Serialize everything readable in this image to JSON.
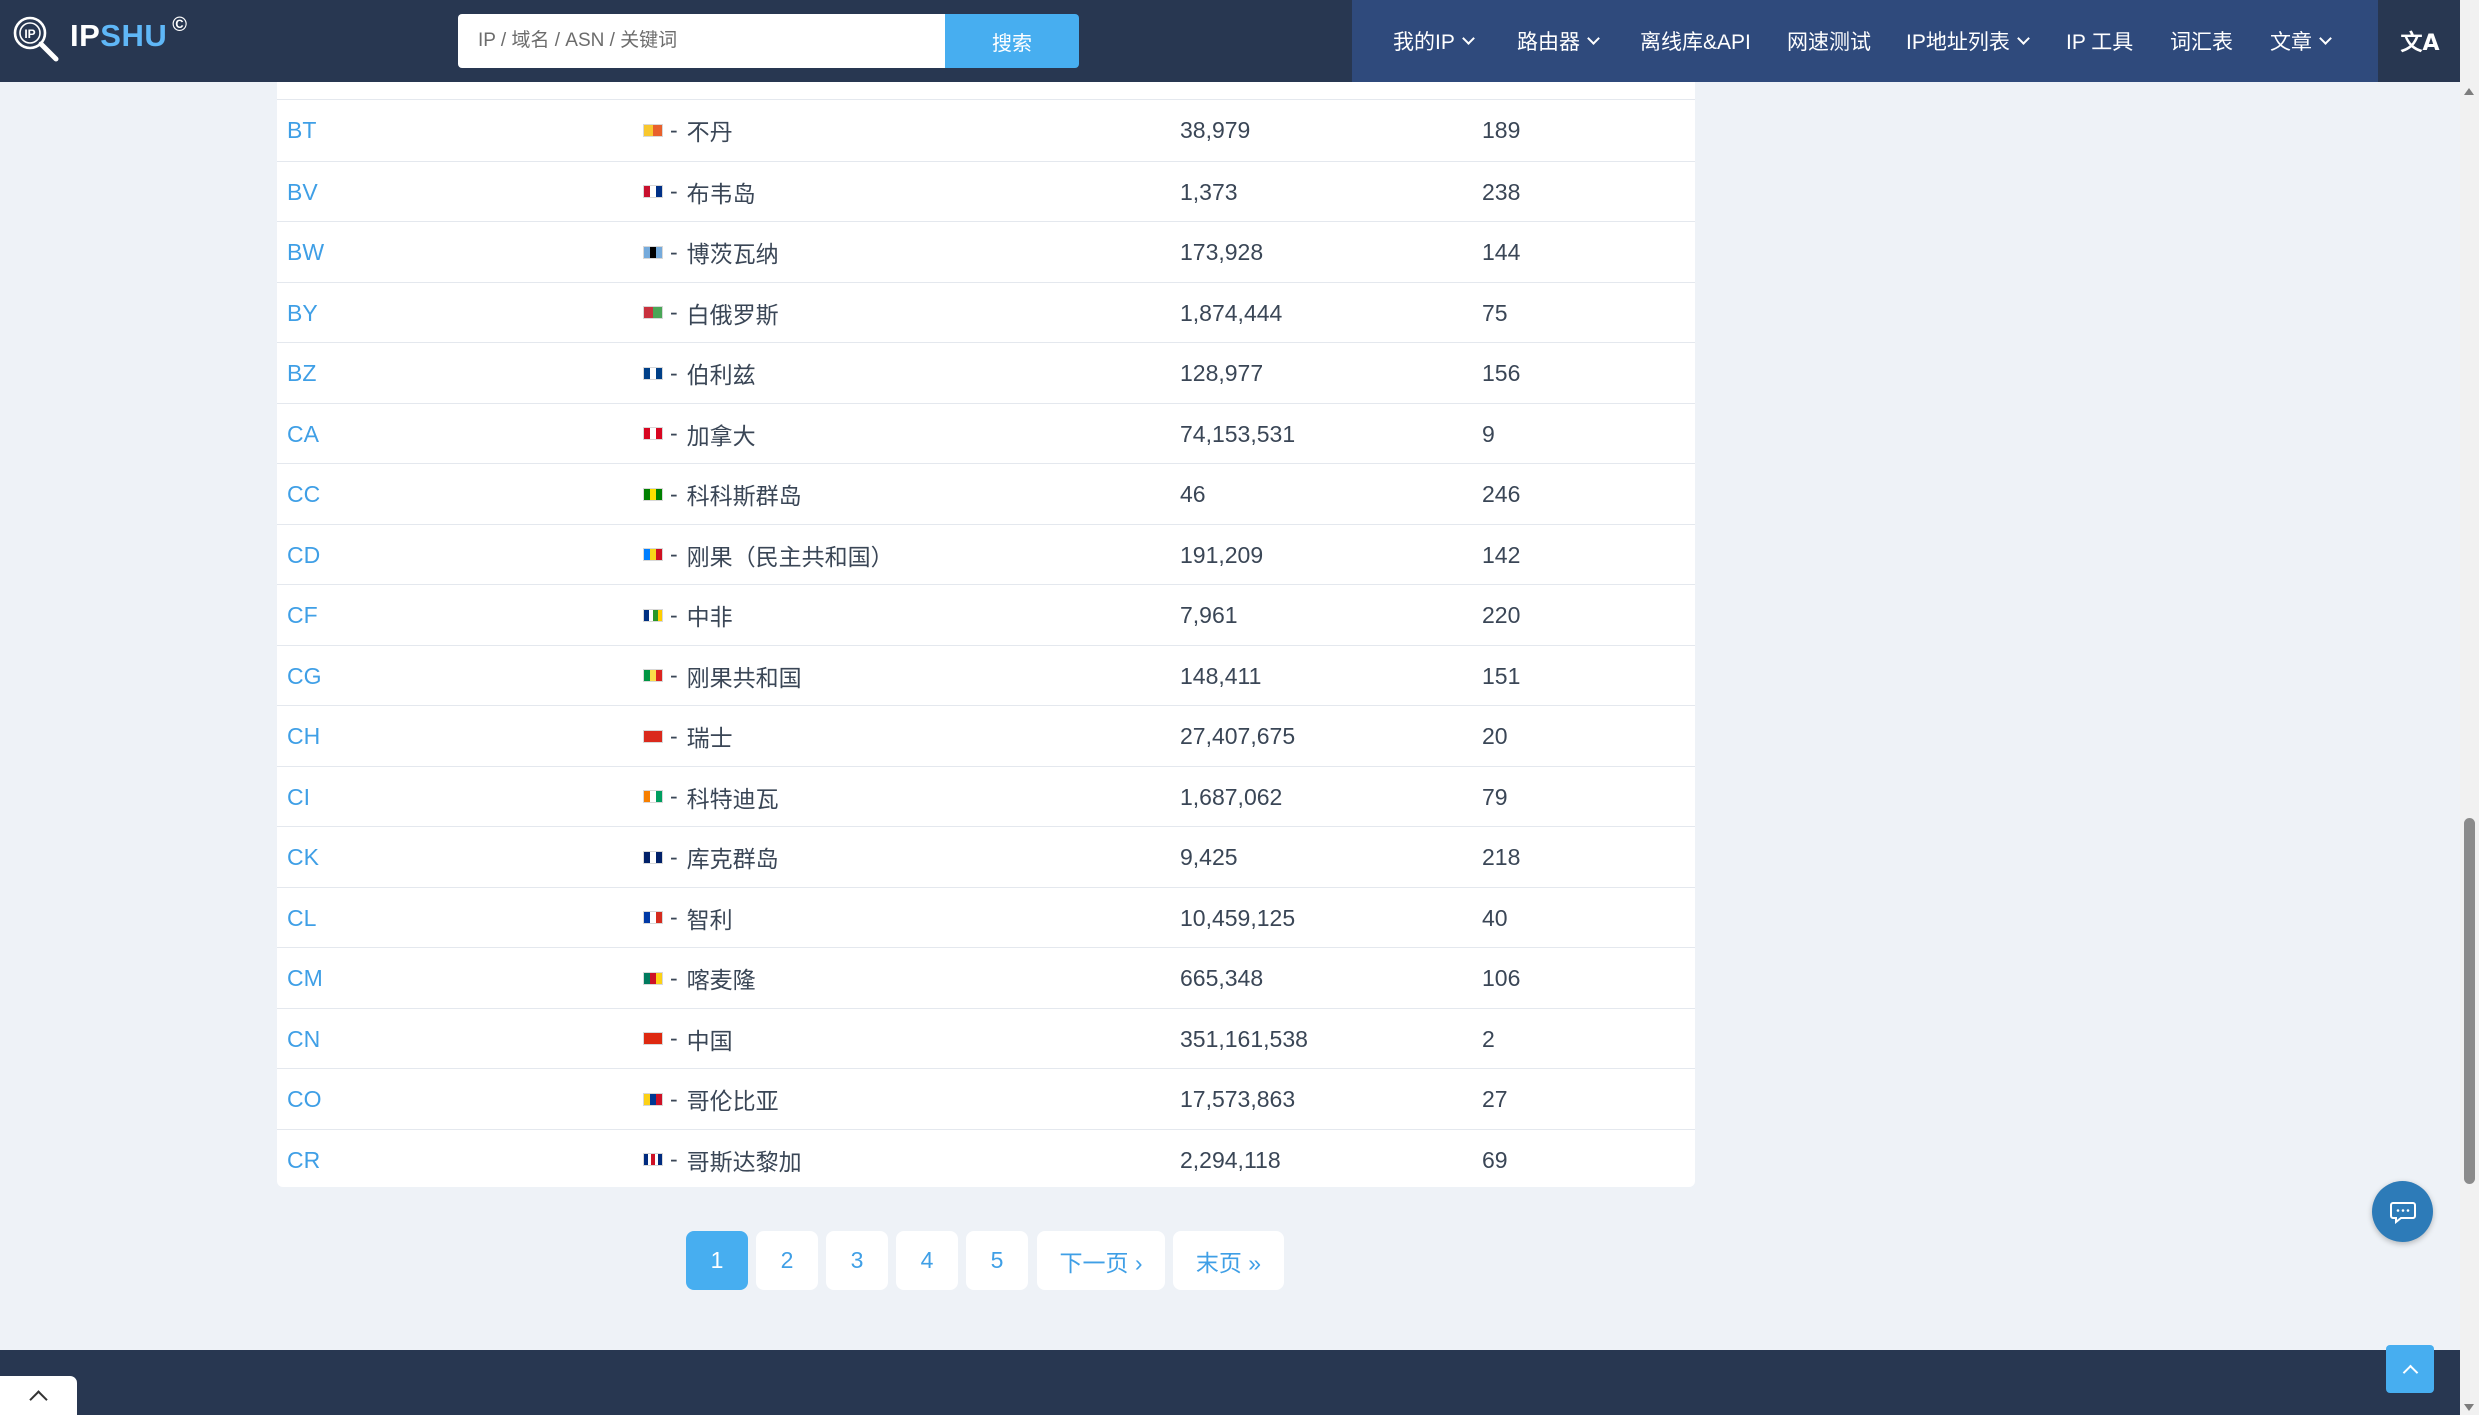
{
  "header": {
    "logo_text_a": "IP",
    "logo_text_b": "SHU",
    "logo_mark": "©",
    "logo_icon": "magnifier-ip-icon",
    "search_placeholder": "IP / 域名 / ASN / 关键词",
    "search_button": "搜索",
    "menu": [
      {
        "label": "我的IP",
        "dropdown": true
      },
      {
        "label": "路由器",
        "dropdown": true
      },
      {
        "label": "离线库&API",
        "dropdown": false
      },
      {
        "label": "网速测试",
        "dropdown": false
      },
      {
        "label": "IP地址列表",
        "dropdown": true
      },
      {
        "label": "IP 工具",
        "dropdown": false
      },
      {
        "label": "词汇表",
        "dropdown": false
      },
      {
        "label": "文章",
        "dropdown": true
      }
    ],
    "language_icon": "translate-icon",
    "language_glyph": "文A"
  },
  "colors": {
    "nav_bg": "#283751",
    "nav_menu_bg": "#2f4a7c",
    "accent": "#47aef0",
    "link": "#3f9fe6",
    "page_bg": "#eef2f7"
  },
  "table": {
    "rows": [
      {
        "code": "BT",
        "country": "不丹",
        "ips": "38,979",
        "rank": "189",
        "flag_colors": [
          "#f8c72e",
          "#e8602c"
        ]
      },
      {
        "code": "BV",
        "country": "布韦岛",
        "ips": "1,373",
        "rank": "238",
        "flag_colors": [
          "#c8102e",
          "#ffffff",
          "#003087"
        ]
      },
      {
        "code": "BW",
        "country": "博茨瓦纳",
        "ips": "173,928",
        "rank": "144",
        "flag_colors": [
          "#75aadb",
          "#000000",
          "#75aadb"
        ]
      },
      {
        "code": "BY",
        "country": "白俄罗斯",
        "ips": "1,874,444",
        "rank": "75",
        "flag_colors": [
          "#c8313e",
          "#4aa657"
        ]
      },
      {
        "code": "BZ",
        "country": "伯利兹",
        "ips": "128,977",
        "rank": "156",
        "flag_colors": [
          "#003f87",
          "#ffffff",
          "#003f87"
        ]
      },
      {
        "code": "CA",
        "country": "加拿大",
        "ips": "74,153,531",
        "rank": "9",
        "flag_colors": [
          "#d80621",
          "#ffffff",
          "#d80621"
        ]
      },
      {
        "code": "CC",
        "country": "科科斯群岛",
        "ips": "46",
        "rank": "246",
        "flag_colors": [
          "#008000",
          "#ffe000",
          "#008000"
        ]
      },
      {
        "code": "CD",
        "country": "刚果（民主共和国）",
        "ips": "191,209",
        "rank": "142",
        "flag_colors": [
          "#007fff",
          "#f7d618",
          "#ce1021"
        ]
      },
      {
        "code": "CF",
        "country": "中非",
        "ips": "7,961",
        "rank": "220",
        "flag_colors": [
          "#003082",
          "#ffffff",
          "#289728",
          "#ffce00"
        ]
      },
      {
        "code": "CG",
        "country": "刚果共和国",
        "ips": "148,411",
        "rank": "151",
        "flag_colors": [
          "#009543",
          "#fbde4a",
          "#dc241f"
        ]
      },
      {
        "code": "CH",
        "country": "瑞士",
        "ips": "27,407,675",
        "rank": "20",
        "flag_colors": [
          "#da291c"
        ]
      },
      {
        "code": "CI",
        "country": "科特迪瓦",
        "ips": "1,687,062",
        "rank": "79",
        "flag_colors": [
          "#f77f00",
          "#ffffff",
          "#009e60"
        ]
      },
      {
        "code": "CK",
        "country": "库克群岛",
        "ips": "9,425",
        "rank": "218",
        "flag_colors": [
          "#012169",
          "#ffffff",
          "#012169"
        ]
      },
      {
        "code": "CL",
        "country": "智利",
        "ips": "10,459,125",
        "rank": "40",
        "flag_colors": [
          "#0039a6",
          "#ffffff",
          "#d52b1e"
        ]
      },
      {
        "code": "CM",
        "country": "喀麦隆",
        "ips": "665,348",
        "rank": "106",
        "flag_colors": [
          "#007a5e",
          "#ce1126",
          "#fcd116"
        ]
      },
      {
        "code": "CN",
        "country": "中国",
        "ips": "351,161,538",
        "rank": "2",
        "flag_colors": [
          "#de2910"
        ]
      },
      {
        "code": "CO",
        "country": "哥伦比亚",
        "ips": "17,573,863",
        "rank": "27",
        "flag_colors": [
          "#fcd116",
          "#003893",
          "#ce1126"
        ]
      },
      {
        "code": "CR",
        "country": "哥斯达黎加",
        "ips": "2,294,118",
        "rank": "69",
        "flag_colors": [
          "#002b7f",
          "#ffffff",
          "#ce1126",
          "#ffffff",
          "#002b7f"
        ]
      }
    ]
  },
  "pagination": {
    "pages": [
      "1",
      "2",
      "3",
      "4",
      "5"
    ],
    "active": "1",
    "next": "下一页 ›",
    "last": "末页 »"
  },
  "widgets": {
    "chat_icon": "chat-bubble-icon",
    "back_to_top_icon": "chevron-up-icon",
    "footer_toggle_icon": "chevron-up-icon"
  }
}
